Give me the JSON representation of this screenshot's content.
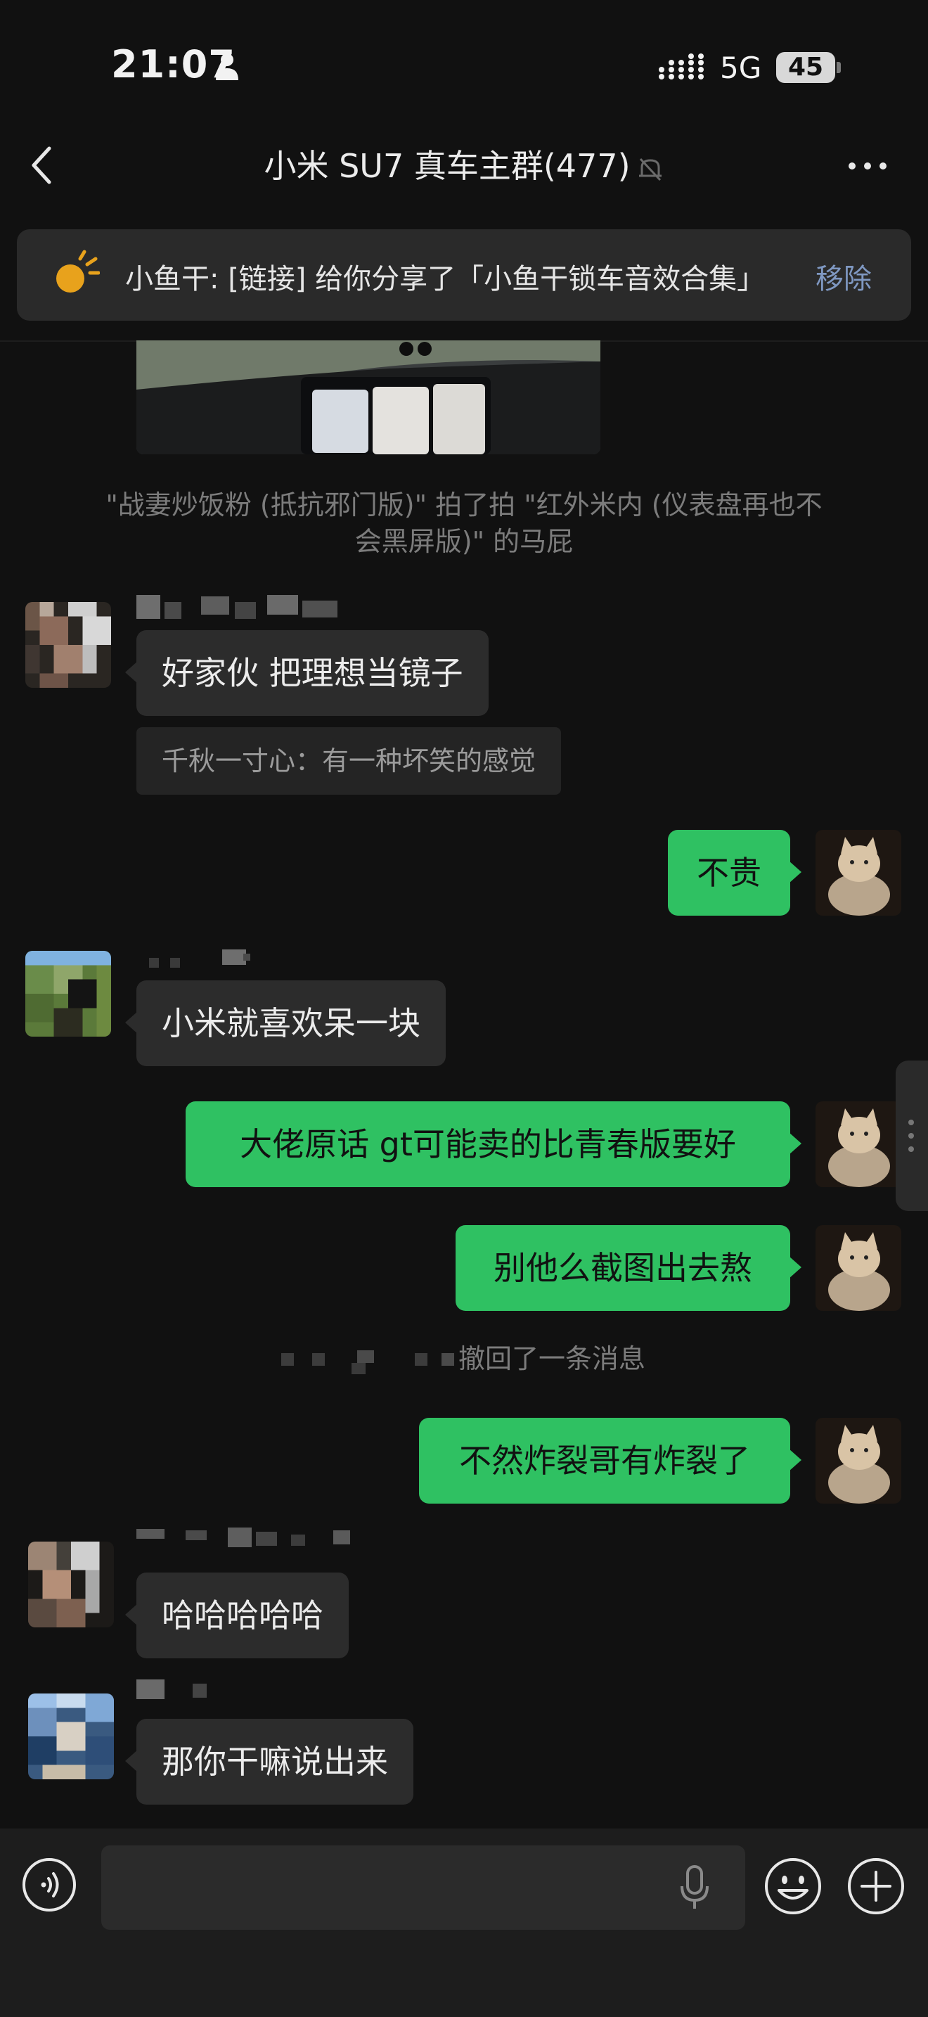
{
  "status_bar": {
    "time": "21:07",
    "network": "5G",
    "battery": "45"
  },
  "nav": {
    "title": "小米 SU7 真车主群(477)"
  },
  "pinned": {
    "text": "小鱼干: [链接] 给你分享了「小鱼干锁车音效合集」",
    "action": "移除"
  },
  "system": {
    "pat_line1": "\"战妻炒饭粉 (抵抗邪门版)\" 拍了拍 \"红外米内 (仪表盘再也不",
    "pat_line2": "会黑屏版)\" 的马屁",
    "recall": "撤回了一条消息"
  },
  "messages": [
    {
      "side": "left",
      "text": "好家伙 把理想当镜子",
      "quote": "千秋一寸心：有一种坏笑的感觉"
    },
    {
      "side": "right",
      "text": "不贵"
    },
    {
      "side": "left",
      "text": "小米就喜欢呆一块"
    },
    {
      "side": "right",
      "text": "大佬原话  gt可能卖的比青春版要好"
    },
    {
      "side": "right",
      "text": "别他么截图出去熬"
    },
    {
      "side": "right",
      "text": "不然炸裂哥有炸裂了"
    },
    {
      "side": "left",
      "text": "哈哈哈哈哈"
    },
    {
      "side": "left",
      "text": "那你干嘛说出来"
    }
  ],
  "icons": [
    "person-icon",
    "signal-icon",
    "back-icon",
    "mute-icon",
    "more-icon",
    "pin-icon",
    "voice-icon",
    "mic-icon",
    "emoji-icon",
    "plus-icon"
  ],
  "colors": {
    "background": "#111111",
    "bubble_self": "#2fc162",
    "bubble_other": "#2c2c2c",
    "link": "#7f98c2"
  }
}
